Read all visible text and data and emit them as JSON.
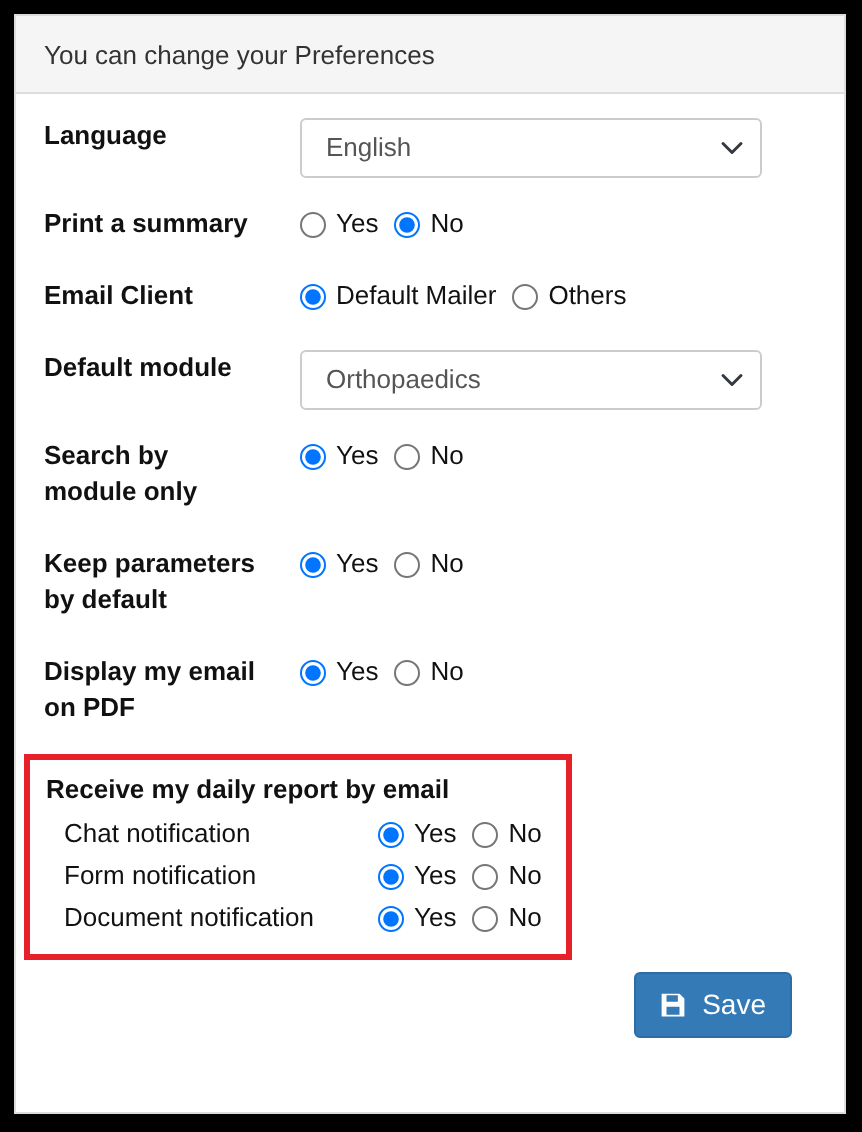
{
  "header": {
    "title": "You can change your Preferences"
  },
  "fields": [
    {
      "kind": "select",
      "label": "Language",
      "value": "English"
    },
    {
      "kind": "radio",
      "label": "Print a summary",
      "options": [
        {
          "label": "Yes",
          "selected": false
        },
        {
          "label": "No",
          "selected": true
        }
      ]
    },
    {
      "kind": "radio",
      "label": "Email Client",
      "options": [
        {
          "label": "Default Mailer",
          "selected": true
        },
        {
          "label": "Others",
          "selected": false
        }
      ]
    },
    {
      "kind": "select",
      "label": "Default module",
      "value": "Orthopaedics"
    },
    {
      "kind": "radio",
      "label": "Search by module only",
      "options": [
        {
          "label": "Yes",
          "selected": true
        },
        {
          "label": "No",
          "selected": false
        }
      ]
    },
    {
      "kind": "radio",
      "label": "Keep parameters by default",
      "options": [
        {
          "label": "Yes",
          "selected": true
        },
        {
          "label": "No",
          "selected": false
        }
      ]
    },
    {
      "kind": "radio",
      "label": "Display my email on PDF",
      "options": [
        {
          "label": "Yes",
          "selected": true
        },
        {
          "label": "No",
          "selected": false
        }
      ]
    }
  ],
  "daily_report": {
    "title": "Receive my daily report by email",
    "highlighted": true,
    "items": [
      {
        "label": "Chat notification",
        "options": [
          {
            "label": "Yes",
            "selected": true
          },
          {
            "label": "No",
            "selected": false
          }
        ]
      },
      {
        "label": "Form notification",
        "options": [
          {
            "label": "Yes",
            "selected": true
          },
          {
            "label": "No",
            "selected": false
          }
        ]
      },
      {
        "label": "Document notification",
        "options": [
          {
            "label": "Yes",
            "selected": true
          },
          {
            "label": "No",
            "selected": false
          }
        ]
      }
    ]
  },
  "save_button": {
    "label": "Save"
  }
}
